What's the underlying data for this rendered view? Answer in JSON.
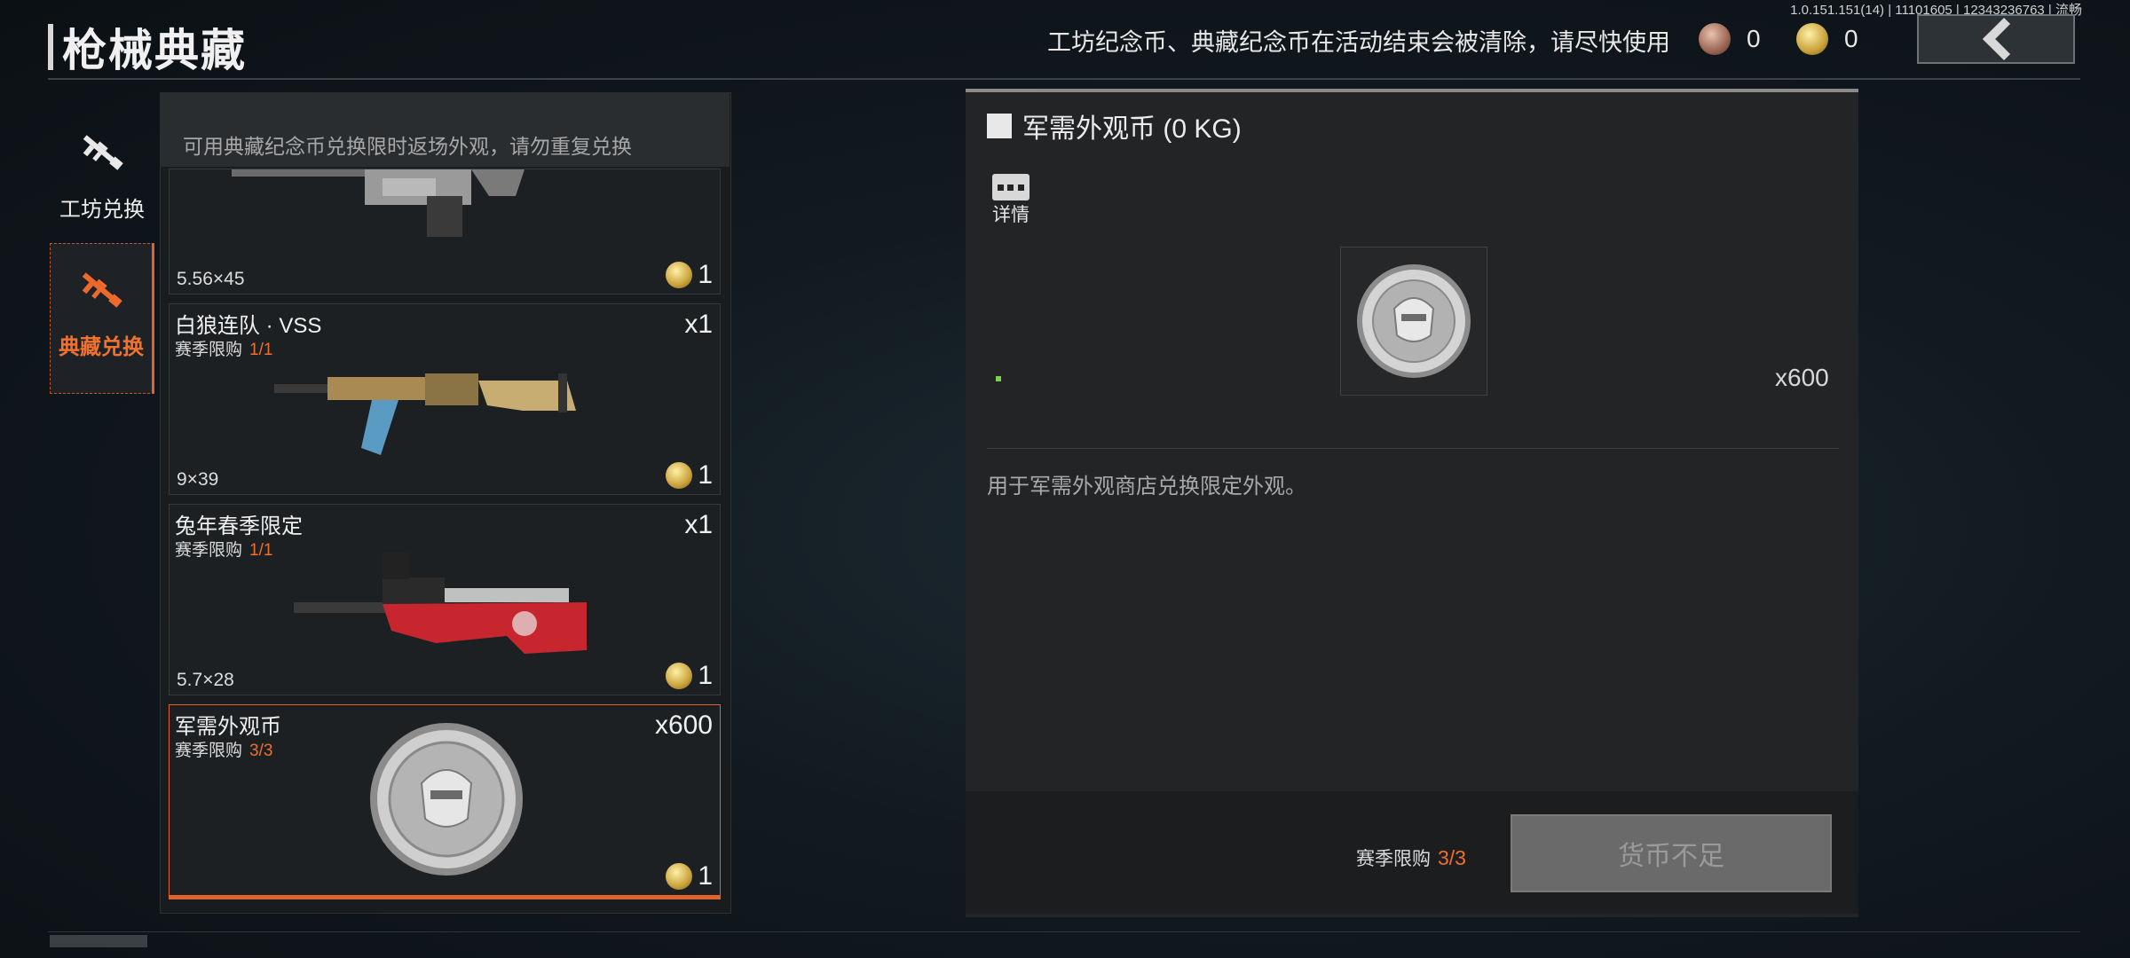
{
  "header": {
    "title": "枪械典藏",
    "notice": "工坊纪念币、典藏纪念币在活动结束会被清除，请尽快使用",
    "version": "1.0.151.151(14) | 11101605 | 12343236763 | 流畅",
    "workshop_coin": "0",
    "collection_coin": "0",
    "back_icon": "chevron-left-icon"
  },
  "tabs": [
    {
      "label": "工坊兑换",
      "icon": "rifle-icon",
      "active": false
    },
    {
      "label": "典藏兑换",
      "icon": "rifle-icon",
      "active": true
    }
  ],
  "list": {
    "hint": "可用典藏纪念币兑换限时返场外观，请勿重复兑换",
    "items": [
      {
        "name": "",
        "limit_label": "",
        "limit_value": "",
        "qty": "",
        "ammo": "5.56×45",
        "price": "1"
      },
      {
        "name": "白狼连队 · VSS",
        "limit_label": "赛季限购",
        "limit_value": "1/1",
        "qty": "x1",
        "ammo": "9×39",
        "price": "1"
      },
      {
        "name": "兔年春季限定",
        "limit_label": "赛季限购",
        "limit_value": "1/1",
        "qty": "x1",
        "ammo": "5.7×28",
        "price": "1"
      },
      {
        "name": "军需外观币",
        "limit_label": "赛季限购",
        "limit_value": "3/3",
        "qty": "x600",
        "ammo": "",
        "price": "1"
      }
    ]
  },
  "detail": {
    "title": "军需外观币 (0 KG)",
    "more_label": "详情",
    "qty": "x600",
    "description": "用于军需外观商店兑换限定外观。",
    "limit_label": "赛季限购",
    "limit_value": "3/3",
    "button_label": "货币不足"
  },
  "colors": {
    "accent": "#e0622c",
    "limit_text": "#f06e2a",
    "button_disabled": "#6a6a6a"
  }
}
